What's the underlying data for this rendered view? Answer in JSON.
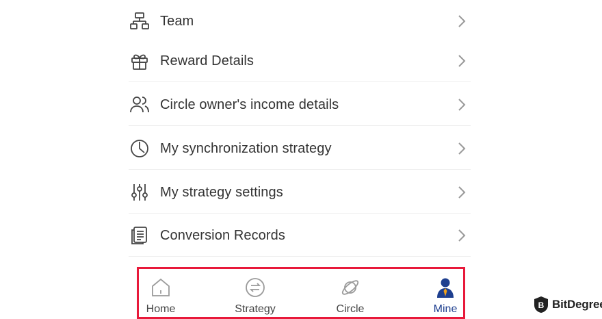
{
  "menu": {
    "items": [
      {
        "label": "Team",
        "icon": "team-hierarchy-icon"
      },
      {
        "label": "Reward Details",
        "icon": "gift-icon"
      },
      {
        "label": "Circle owner's income details",
        "icon": "users-icon"
      },
      {
        "label": "My synchronization strategy",
        "icon": "pie-clock-icon"
      },
      {
        "label": "My strategy settings",
        "icon": "sliders-icon"
      },
      {
        "label": "Conversion Records",
        "icon": "document-list-icon"
      }
    ]
  },
  "tabbar": {
    "tabs": [
      {
        "label": "Home",
        "icon": "home-icon"
      },
      {
        "label": "Strategy",
        "icon": "swap-arrows-icon"
      },
      {
        "label": "Circle",
        "icon": "planet-icon"
      },
      {
        "label": "Mine",
        "icon": "user-avatar-icon",
        "active": true
      }
    ],
    "highlight_color": "#e8193a",
    "active_color": "#1e3f8f"
  },
  "watermark": {
    "text": "BitDegree"
  }
}
